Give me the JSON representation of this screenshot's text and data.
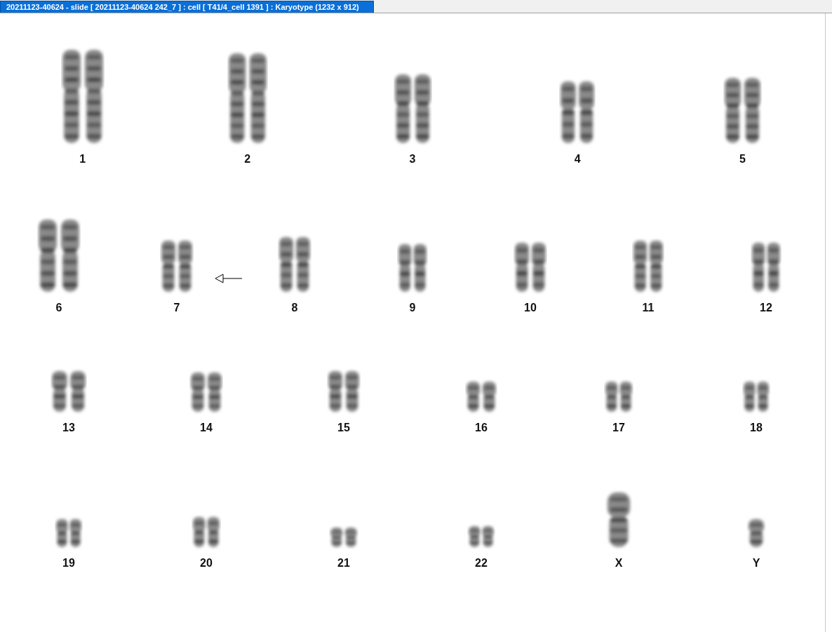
{
  "window": {
    "title": "20211123-40624 - slide [ 20211123-40624 242_7 ] : cell [ T41/4_cell 1391 ] : Karyotype  (1232 x 912)"
  },
  "karyotype": {
    "rows": [
      {
        "chromosomes": [
          {
            "label": "1",
            "kind": "pair",
            "marked": false
          },
          {
            "label": "2",
            "kind": "pair",
            "marked": false
          },
          {
            "label": "3",
            "kind": "pair",
            "marked": false
          },
          {
            "label": "4",
            "kind": "pair",
            "marked": false
          },
          {
            "label": "5",
            "kind": "pair",
            "marked": false
          }
        ]
      },
      {
        "chromosomes": [
          {
            "label": "6",
            "kind": "pair",
            "marked": false
          },
          {
            "label": "7",
            "kind": "pair",
            "marked": true
          },
          {
            "label": "8",
            "kind": "pair",
            "marked": false
          },
          {
            "label": "9",
            "kind": "pair",
            "marked": false
          },
          {
            "label": "10",
            "kind": "pair",
            "marked": false
          },
          {
            "label": "11",
            "kind": "pair",
            "marked": false
          },
          {
            "label": "12",
            "kind": "pair",
            "marked": false
          }
        ]
      },
      {
        "chromosomes": [
          {
            "label": "13",
            "kind": "pair",
            "marked": false
          },
          {
            "label": "14",
            "kind": "pair",
            "marked": false
          },
          {
            "label": "15",
            "kind": "pair",
            "marked": false
          },
          {
            "label": "16",
            "kind": "pair",
            "marked": false
          },
          {
            "label": "17",
            "kind": "pair",
            "marked": false
          },
          {
            "label": "18",
            "kind": "pair",
            "marked": false
          }
        ]
      },
      {
        "chromosomes": [
          {
            "label": "19",
            "kind": "pair",
            "marked": false
          },
          {
            "label": "20",
            "kind": "pair",
            "marked": false
          },
          {
            "label": "21",
            "kind": "pair",
            "marked": false
          },
          {
            "label": "22",
            "kind": "pair",
            "marked": false
          },
          {
            "label": "X",
            "kind": "single",
            "marked": false
          },
          {
            "label": "Y",
            "kind": "single",
            "marked": false
          }
        ]
      }
    ]
  }
}
